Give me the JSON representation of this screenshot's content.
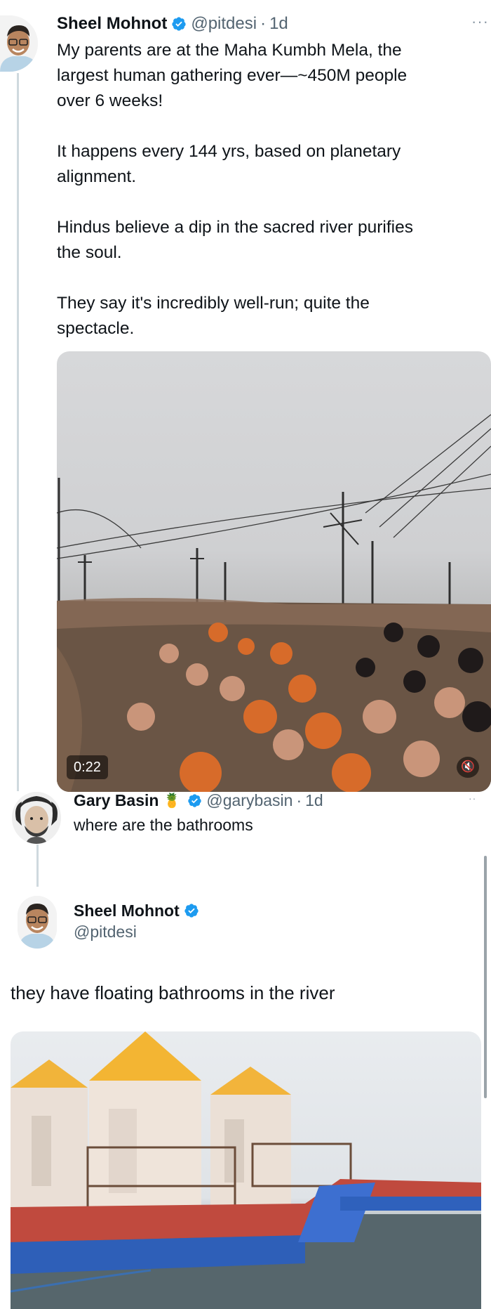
{
  "tweet1": {
    "display_name": "Sheel Mohnot",
    "handle": "@pitdesi",
    "separator": "·",
    "time": "1d",
    "more_icon": "more-horizontal-icon",
    "paragraphs": [
      [
        "My parents are at the Maha Kumbh Mela, the",
        "largest human gathering ever—~450M people",
        "over 6 weeks!"
      ],
      [
        "It happens every 144 yrs, based on planetary",
        "alignment."
      ],
      [
        "Hindus believe a dip in the sacred river purifies",
        "the soul."
      ],
      [
        "They say it's incredibly well-run; quite the",
        "spectacle."
      ]
    ],
    "video": {
      "duration": "0:22",
      "mute_icon": "speaker-muted-icon"
    }
  },
  "reply": {
    "display_name": "Gary Basin",
    "emoji": "🍍",
    "handle": "@garybasin",
    "separator": "·",
    "time": "1d",
    "text": "where are the bathrooms"
  },
  "tweet2": {
    "display_name": "Sheel Mohnot",
    "handle": "@pitdesi",
    "text": "they have floating bathrooms in the river"
  },
  "colors": {
    "text": "#0f1419",
    "secondary": "#536471",
    "verified": "#1d9bf0",
    "thread_line": "#cfd9de"
  }
}
